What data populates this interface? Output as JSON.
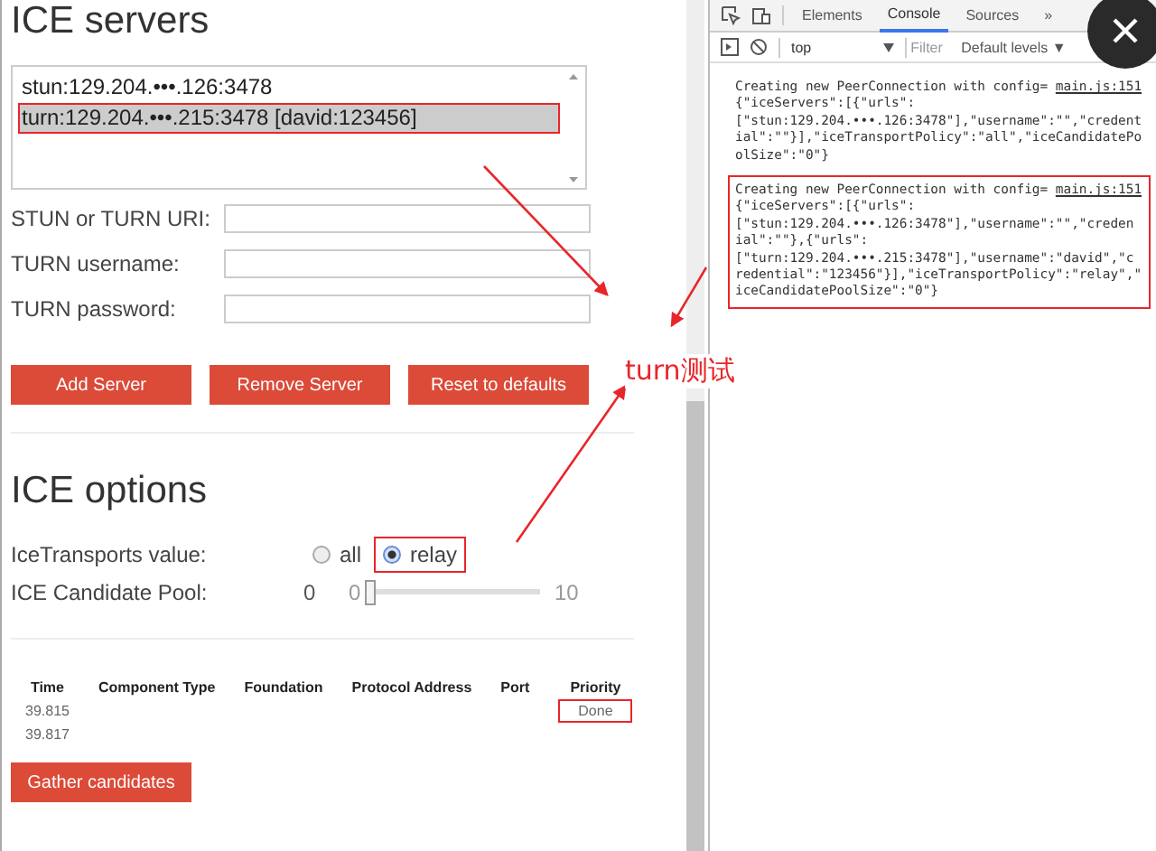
{
  "ice_servers": {
    "title": "ICE servers",
    "servers": [
      {
        "label": "stun:129.204.•••.126:3478",
        "selected": false,
        "highlighted": false
      },
      {
        "label": "turn:129.204.•••.215:3478 [david:123456]",
        "selected": true,
        "highlighted": true
      }
    ],
    "fields": [
      {
        "label": "STUN or TURN URI:"
      },
      {
        "label": "TURN username:"
      },
      {
        "label": "TURN password:"
      }
    ],
    "buttons": [
      "Add Server",
      "Remove Server",
      "Reset to defaults"
    ]
  },
  "ice_options": {
    "title": "ICE options",
    "transports_label": "IceTransports value:",
    "transports": [
      {
        "kind": "plain",
        "label": "all",
        "selected": false
      },
      {
        "kind": "boxed",
        "label": "relay",
        "selected": true
      }
    ],
    "pool_label": "ICE Candidate Pool:",
    "pool_value": "0",
    "pool_min": "0",
    "pool_max": "10",
    "level": 0
  },
  "candidates": {
    "columns": [
      "Time",
      "Component Type",
      "Foundation",
      "Protocol Address",
      "Port",
      "Priority"
    ],
    "rows": [
      {
        "time": "39.815",
        "priority": "Done",
        "priority_highlighted": true
      },
      {
        "time": "39.817"
      }
    ],
    "button": "Gather candidates"
  },
  "devtools": {
    "tabs": [
      {
        "label": "Elements",
        "selected": false
      },
      {
        "label": "Console",
        "selected": true
      },
      {
        "label": "Sources",
        "selected": false
      }
    ],
    "more": "»",
    "context": "top",
    "filter_placeholder": "Filter",
    "levels": "Default levels ▼",
    "entries": [
      {
        "highlighted": false,
        "source": "main.js:151",
        "lines": [
          "Creating new PeerConnection with config=",
          "{\"iceServers\":[{\"urls\":",
          "[\"stun:129.204.•••.126:3478\"],\"username\":\"\",\"credent",
          "ial\":\"\"}],\"iceTransportPolicy\":\"all\",\"iceCandidatePo",
          "olSize\":\"0\"}"
        ]
      },
      {
        "highlighted": true,
        "source": "main.js:151",
        "lines": [
          "Creating new PeerConnection with config=",
          "{\"iceServers\":[{\"urls\":",
          "[\"stun:129.204.•••.126:3478\"],\"username\":\"\",\"creden",
          "ial\":\"\"},{\"urls\":",
          "[\"turn:129.204.•••.215:3478\"],\"username\":\"david\",\"c",
          "redential\":\"123456\"}],\"iceTransportPolicy\":\"relay\",\"",
          "iceCandidatePoolSize\":\"0\"}"
        ]
      }
    ]
  },
  "annotation": {
    "label": "turn测试"
  }
}
